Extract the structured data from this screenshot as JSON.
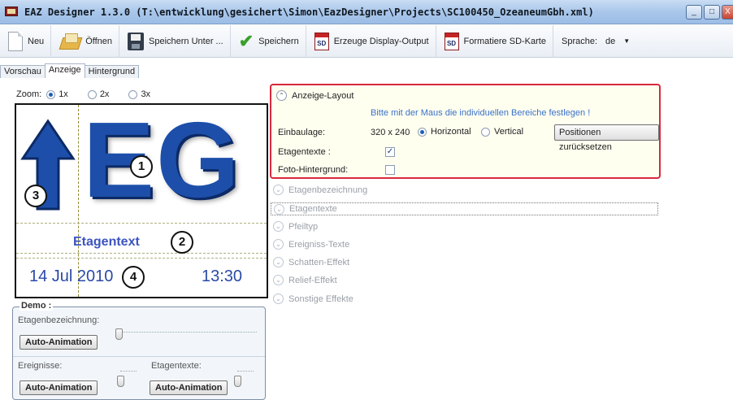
{
  "window": {
    "title": "EAZ Designer 1.3.0 (T:\\entwicklung\\gesichert\\Simon\\EazDesigner\\Projects\\SC100450_OzeaneumGbh.xml)",
    "buttons": {
      "minimize": "_",
      "maximize": "□",
      "close": "X"
    }
  },
  "toolbar": {
    "new_label": "Neu",
    "open_label": "Öffnen",
    "save_as_label": "Speichern Unter ...",
    "save_label": "Speichern",
    "display_output_label": "Erzeuge Display-Output",
    "format_sd_label": "Formatiere SD-Karte",
    "sd_icon_text": "SD",
    "language_label": "Sprache:",
    "language_value": "de",
    "language_arrow": "▼"
  },
  "tabs": [
    "Vorschau",
    "Anzeige",
    "Hintergrund"
  ],
  "zoom": {
    "label": "Zoom:",
    "options": [
      "1x",
      "2x",
      "3x"
    ],
    "selected": "1x"
  },
  "preview": {
    "eg_text_e": "E",
    "eg_text_g": "G",
    "etagentext": "Etagentext",
    "date": "14 Jul 2010",
    "time": "13:30",
    "markers": [
      "1",
      "2",
      "3",
      "4"
    ],
    "colors": {
      "primary": "#1d4faa",
      "text": "#3b54c0"
    }
  },
  "demo": {
    "legend": "Demo :",
    "etagenbezeichnung_label": "Etagenbezeichnung:",
    "ereignisse_label": "Ereignisse:",
    "etagentexte_label": "Etagentexte:",
    "auto_animation": "Auto-Animation"
  },
  "layout_section": {
    "title": "Anzeige-Layout",
    "hint": "Bitte mit der Maus die individuellen Bereiche festlegen !",
    "einbaulage_label": "Einbaulage:",
    "resolution": "320 x 240",
    "orientation_options": [
      "Horizontal",
      "Vertical"
    ],
    "orientation_selected": "Horizontal",
    "reset_button": "Positionen zurücksetzen",
    "etagentexte_label": "Etagentexte :",
    "etagentexte_checked": true,
    "foto_hintergrund_label": "Foto-Hintergrund:",
    "foto_hintergrund_checked": false,
    "check_mark": "✓",
    "accent_color": "#d8283e"
  },
  "sections": [
    "Etagenbezeichnung",
    "Etagentexte",
    "Pfeiltyp",
    "Ereigniss-Texte",
    "Schatten-Effekt",
    "Relief-Effekt",
    "Sonstige Effekte"
  ],
  "chevron": "⌄",
  "chevron_up": "⌃"
}
